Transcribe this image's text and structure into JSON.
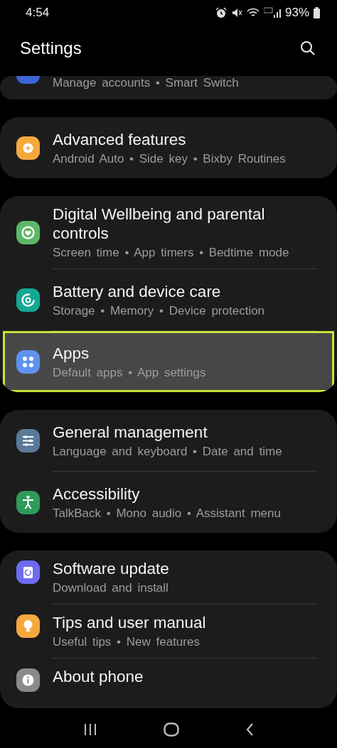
{
  "status_bar": {
    "time": "4:54",
    "battery": "93%"
  },
  "header": {
    "title": "Settings"
  },
  "groups": [
    {
      "items": [
        {
          "subtitle": "Manage accounts • Smart Switch",
          "color": "#3e64d6",
          "selected": false
        }
      ]
    },
    {
      "items": [
        {
          "title": "Advanced features",
          "subtitle": "Android Auto • Side key • Bixby Routines",
          "color": "#f5a93c",
          "selected": false
        }
      ]
    },
    {
      "items": [
        {
          "title": "Digital Wellbeing and parental controls",
          "subtitle": "Screen time • App timers • Bedtime mode",
          "color": "#5db767",
          "selected": false
        },
        {
          "title": "Battery and device care",
          "subtitle": "Storage • Memory • Device protection",
          "color": "#14a894",
          "selected": false
        },
        {
          "title": "Apps",
          "subtitle": "Default apps • App settings",
          "color": "#5f93f0",
          "selected": true
        }
      ]
    },
    {
      "items": [
        {
          "title": "General management",
          "subtitle": "Language and keyboard • Date and time",
          "color": "#5b7a99",
          "selected": false
        },
        {
          "title": "Accessibility",
          "subtitle": "TalkBack • Mono audio • Assistant menu",
          "color": "#2f9a5a",
          "selected": false
        }
      ]
    },
    {
      "items": [
        {
          "title": "Software update",
          "subtitle": "Download and install",
          "color": "#6d6bf0",
          "selected": false
        },
        {
          "title": "Tips and user manual",
          "subtitle": "Useful tips • New features",
          "color": "#f5a93c",
          "selected": false
        },
        {
          "title": "About phone",
          "color": "#8a8a8a",
          "selected": false
        }
      ]
    }
  ]
}
